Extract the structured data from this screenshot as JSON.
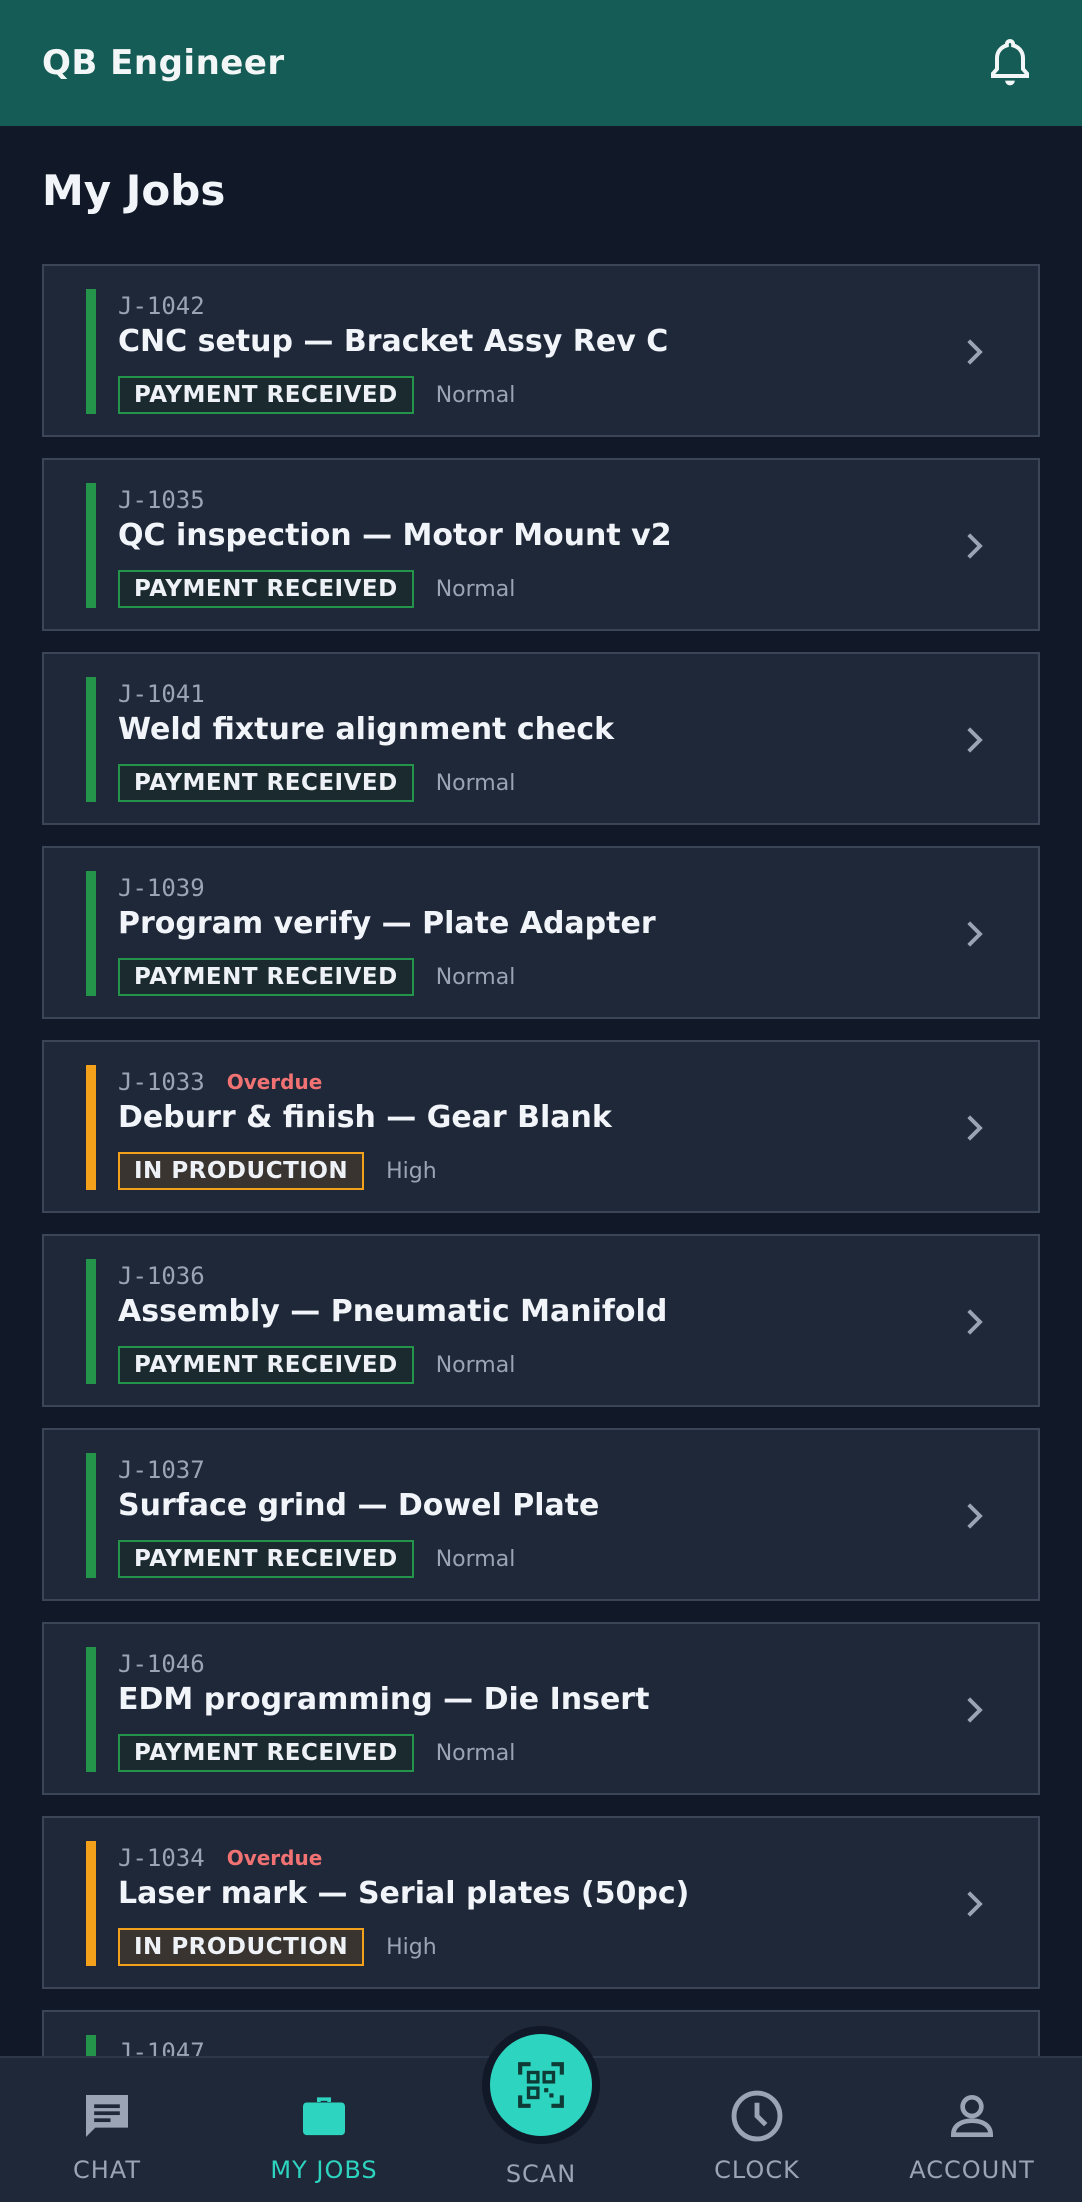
{
  "app": {
    "title": "QB Engineer"
  },
  "page": {
    "title": "My Jobs"
  },
  "colors": {
    "appbar": "#145c55",
    "background": "#111827",
    "card": "#1f2839",
    "paid": "#23944a",
    "production": "#f3a11a",
    "accent": "#2dd4bf",
    "overdue": "#f07272"
  },
  "jobs": [
    {
      "id": "J-1042",
      "title": "CNC setup — Bracket Assy Rev C",
      "status": "PAYMENT RECEIVED",
      "status_kind": "paid",
      "priority": "Normal",
      "overdue": ""
    },
    {
      "id": "J-1035",
      "title": "QC inspection — Motor Mount v2",
      "status": "PAYMENT RECEIVED",
      "status_kind": "paid",
      "priority": "Normal",
      "overdue": ""
    },
    {
      "id": "J-1041",
      "title": "Weld fixture alignment check",
      "status": "PAYMENT RECEIVED",
      "status_kind": "paid",
      "priority": "Normal",
      "overdue": ""
    },
    {
      "id": "J-1039",
      "title": "Program verify — Plate Adapter",
      "status": "PAYMENT RECEIVED",
      "status_kind": "paid",
      "priority": "Normal",
      "overdue": ""
    },
    {
      "id": "J-1033",
      "title": "Deburr & finish — Gear Blank",
      "status": "IN PRODUCTION",
      "status_kind": "prod",
      "priority": "High",
      "overdue": "Overdue"
    },
    {
      "id": "J-1036",
      "title": "Assembly — Pneumatic Manifold",
      "status": "PAYMENT RECEIVED",
      "status_kind": "paid",
      "priority": "Normal",
      "overdue": ""
    },
    {
      "id": "J-1037",
      "title": "Surface grind — Dowel Plate",
      "status": "PAYMENT RECEIVED",
      "status_kind": "paid",
      "priority": "Normal",
      "overdue": ""
    },
    {
      "id": "J-1046",
      "title": "EDM programming — Die Insert",
      "status": "PAYMENT RECEIVED",
      "status_kind": "paid",
      "priority": "Normal",
      "overdue": ""
    },
    {
      "id": "J-1034",
      "title": "Laser mark — Serial plates (50pc)",
      "status": "IN PRODUCTION",
      "status_kind": "prod",
      "priority": "High",
      "overdue": "Overdue"
    },
    {
      "id": "J-1047",
      "title": "",
      "status": "",
      "status_kind": "paid",
      "priority": "",
      "overdue": ""
    }
  ],
  "nav": {
    "chat": "CHAT",
    "myjobs": "MY JOBS",
    "scan": "SCAN",
    "clock": "CLOCK",
    "account": "ACCOUNT",
    "active": "myjobs"
  },
  "icons": {
    "bell": "bell-icon",
    "chevron": "chevron-right-icon",
    "chat": "chat-icon",
    "briefcase": "briefcase-icon",
    "qr": "qr-scan-icon",
    "clock": "clock-icon",
    "account": "account-icon"
  }
}
